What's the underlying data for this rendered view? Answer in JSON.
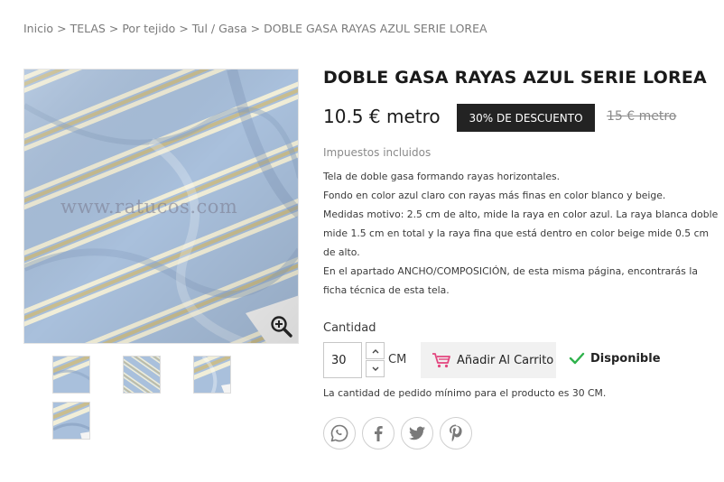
{
  "breadcrumb": {
    "items": [
      "Inicio",
      "TELAS",
      "Por tejido",
      "Tul / Gasa",
      "DOBLE GASA RAYAS AZUL SERIE LOREA"
    ],
    "separator": ">"
  },
  "gallery": {
    "watermark": "www.ratucos.com",
    "zoom_icon": "zoom-in-icon"
  },
  "product": {
    "title": "DOBLE GASA RAYAS AZUL SERIE LOREA",
    "price": "10.5 € metro",
    "discount": "30% DE DESCUENTO",
    "old_price": "15 € metro",
    "tax": "Impuestos incluidos",
    "description": [
      "Tela de doble gasa formando rayas horizontales.",
      "Fondo en color azul claro con rayas más finas en color blanco y beige.",
      "Medidas motivo: 2.5 cm de alto, mide la raya en color azul. La raya blanca doble mide 1.5 cm en total y la raya fina que está dentro en color beige mide 0.5 cm de alto.",
      "En el apartado ANCHO/COMPOSICIÓN, de esta misma página, encontrarás la ficha técnica de esta tela."
    ]
  },
  "purchase": {
    "quantity_label": "Cantidad",
    "quantity_value": "30",
    "unit": "CM",
    "add_to_cart": "Añadir Al Carrito",
    "availability": "Disponible",
    "min_qty_note": "La cantidad de pedido mínimo para el producto es 30 CM."
  },
  "share": {
    "icons": [
      "whatsapp-icon",
      "facebook-icon",
      "twitter-icon",
      "pinterest-icon"
    ]
  },
  "colors": {
    "fabric_blue": "#a9c0dc",
    "stripe_cream": "#f1eed8",
    "stripe_beige": "#c9bd8e",
    "badge_bg": "#232323",
    "available_green": "#2fb24c",
    "cart_pink": "#e3457e"
  }
}
